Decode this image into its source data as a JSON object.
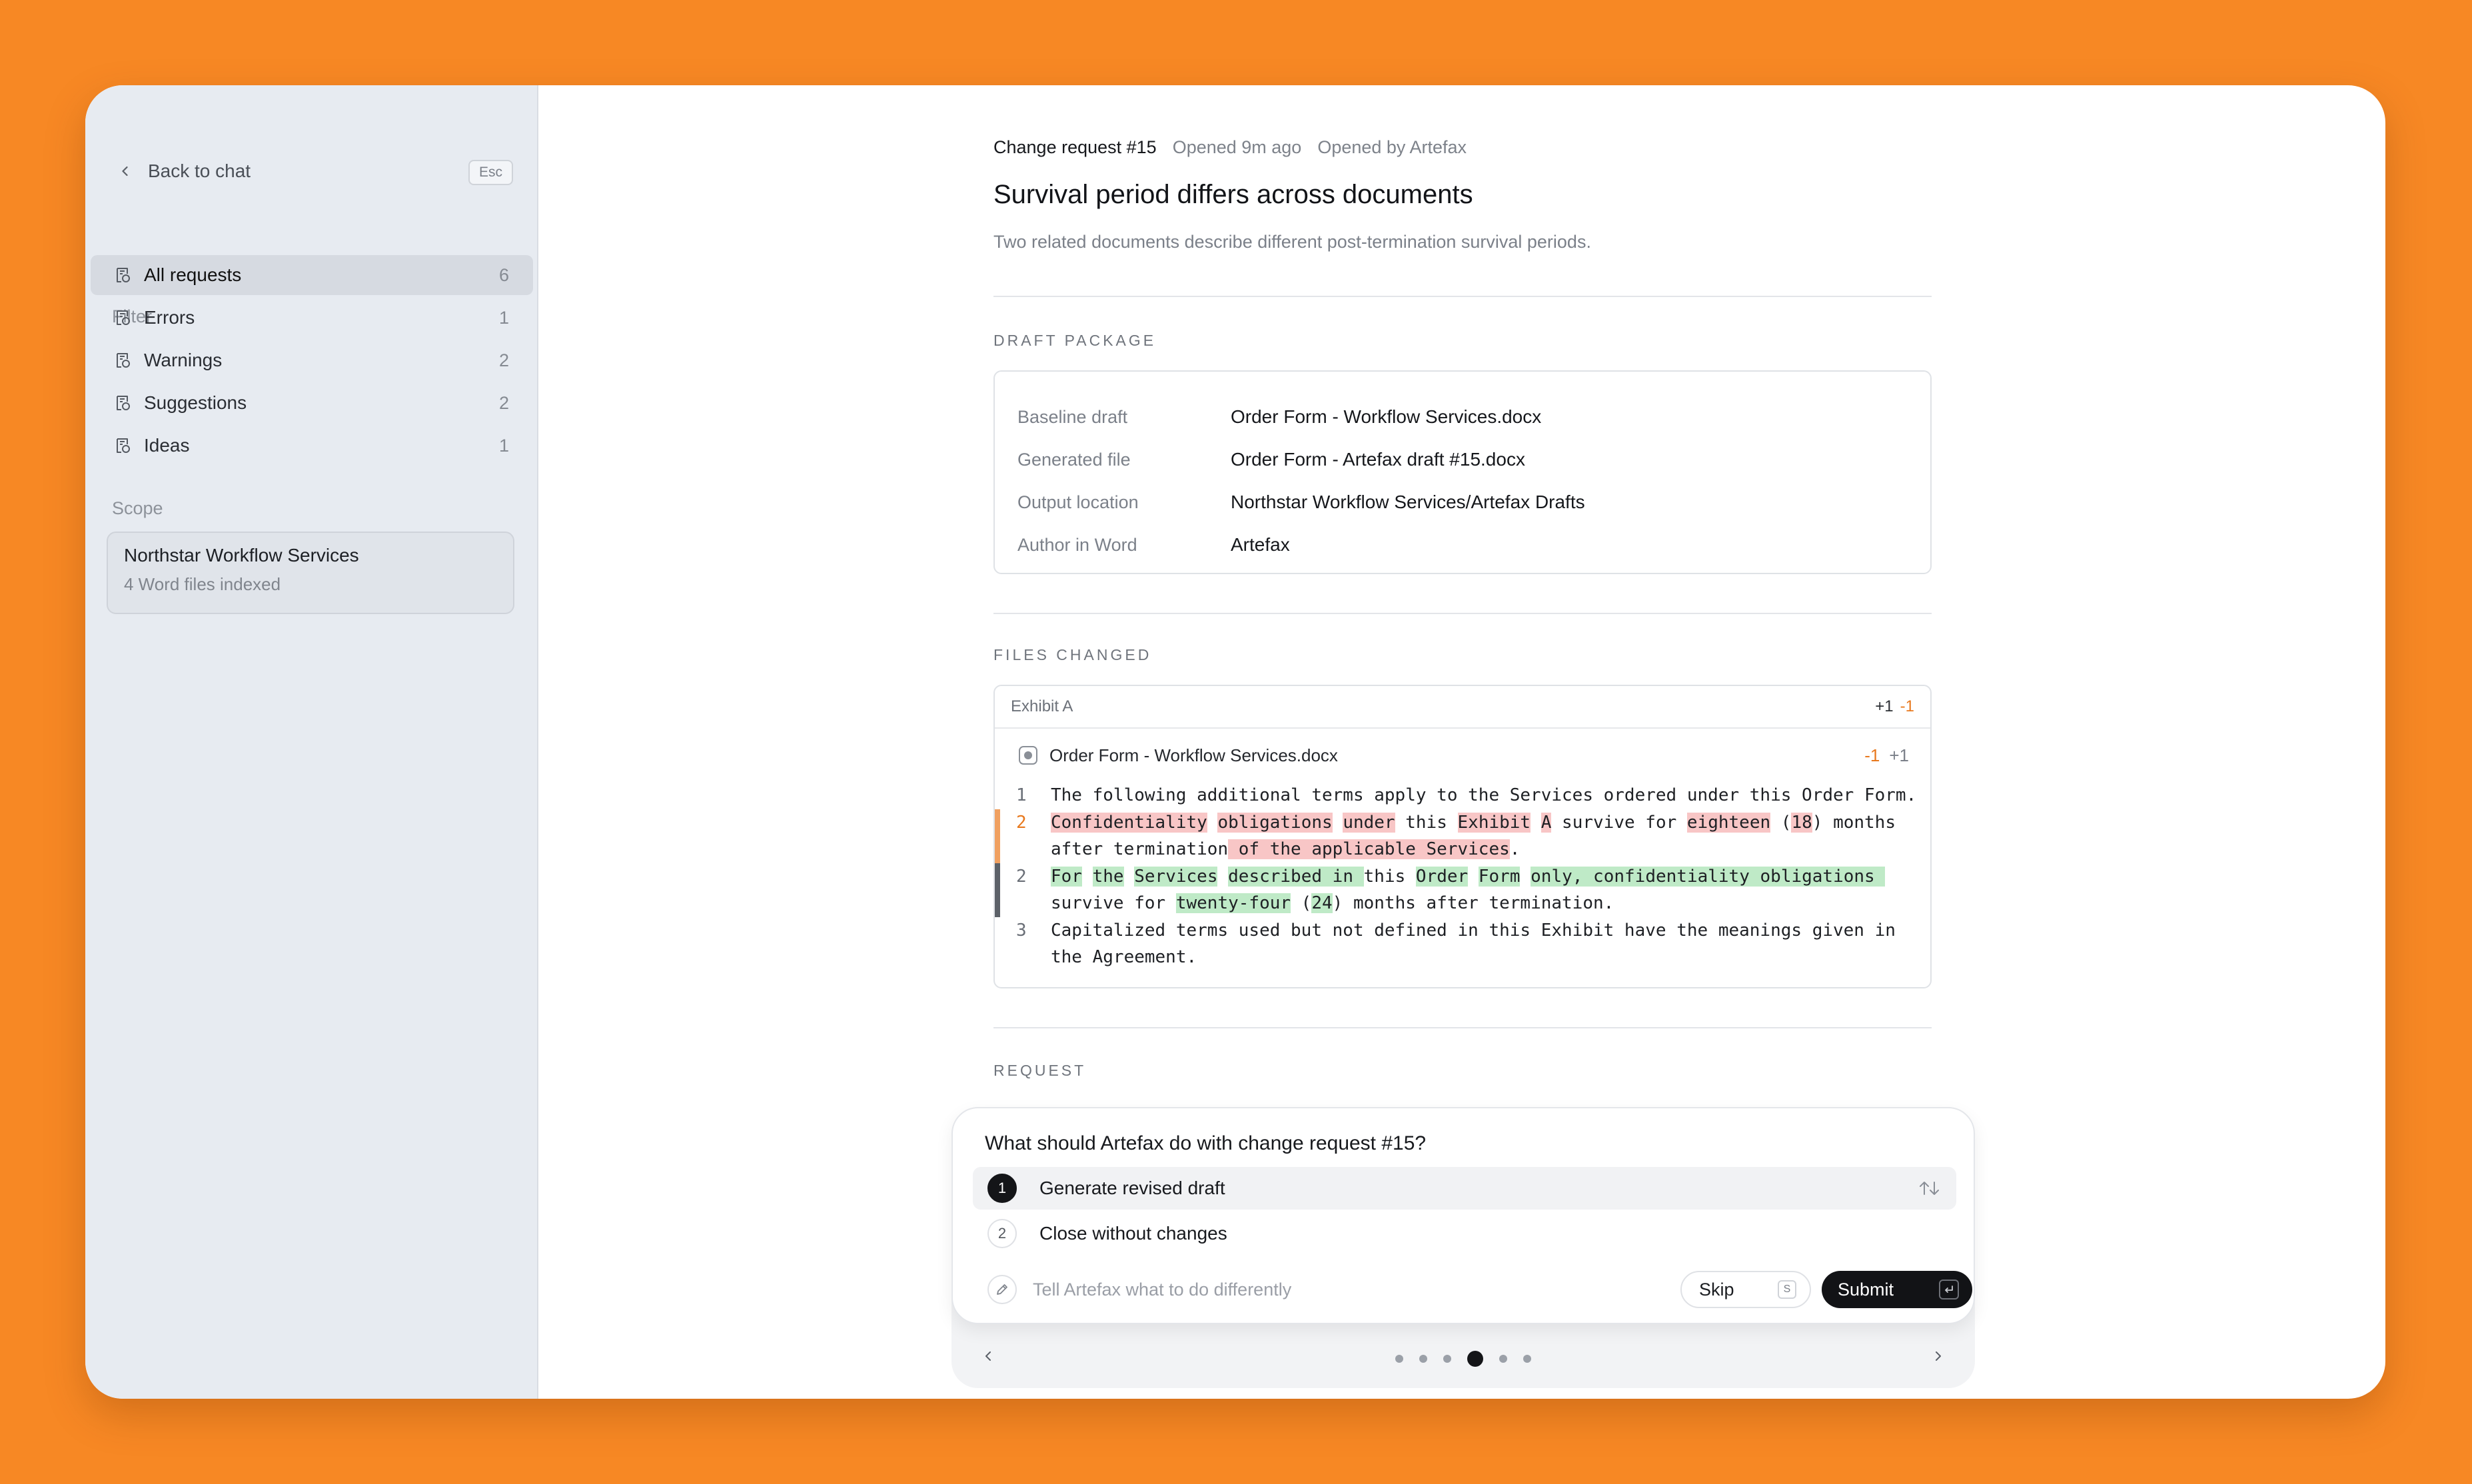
{
  "sidebar": {
    "back_label": "Back to chat",
    "esc_key": "Esc",
    "filter_label": "Filter",
    "filters": [
      {
        "label": "All requests",
        "count": "6",
        "active": true
      },
      {
        "label": "Errors",
        "count": "1"
      },
      {
        "label": "Warnings",
        "count": "2"
      },
      {
        "label": "Suggestions",
        "count": "2"
      },
      {
        "label": "Ideas",
        "count": "1"
      }
    ],
    "scope_label": "Scope",
    "scope": {
      "title": "Northstar Workflow Services",
      "subtitle": "4 Word files indexed"
    }
  },
  "request": {
    "id": "Change request #15",
    "opened": "Opened 9m ago",
    "opened_by": "Opened by Artefax",
    "title": "Survival period differs across documents",
    "description": "Two related documents describe different post-termination survival periods."
  },
  "draft_package": {
    "caption": "DRAFT PACKAGE",
    "rows": [
      {
        "key": "Baseline draft",
        "value": "Order Form - Workflow Services.docx"
      },
      {
        "key": "Generated file",
        "value": "Order Form - Artefax draft #15.docx"
      },
      {
        "key": "Output location",
        "value": "Northstar Workflow Services/Artefax Drafts"
      },
      {
        "key": "Author in Word",
        "value": "Artefax"
      }
    ]
  },
  "files_changed": {
    "caption": "FILES CHANGED",
    "section": "Exhibit A",
    "header_add": "+1",
    "header_del": "-1",
    "file_name": "Order Form - Workflow Services.docx",
    "file_del": "-1",
    "file_add": "+1",
    "lines": [
      {
        "num": "1",
        "kind": "ctx",
        "segments": [
          {
            "t": "The following additional terms apply to the Services ordered under this Order Form."
          }
        ]
      },
      {
        "num": "2",
        "kind": "rem",
        "segments": [
          {
            "t": "Confidentiality",
            "h": "r"
          },
          {
            "t": " "
          },
          {
            "t": "obligations",
            "h": "r"
          },
          {
            "t": " "
          },
          {
            "t": "under",
            "h": "r"
          },
          {
            "t": " this "
          },
          {
            "t": "Exhibit",
            "h": "r"
          },
          {
            "t": " "
          },
          {
            "t": "A",
            "h": "r"
          },
          {
            "t": " survive for "
          },
          {
            "t": "eighteen",
            "h": "r"
          },
          {
            "t": " ("
          },
          {
            "t": "18",
            "h": "r"
          },
          {
            "t": ") months after termination"
          },
          {
            "t": " of the applicable Services",
            "h": "r"
          },
          {
            "t": "."
          }
        ]
      },
      {
        "num": "2",
        "kind": "addl",
        "segments": [
          {
            "t": "For",
            "h": "g"
          },
          {
            "t": " "
          },
          {
            "t": "the",
            "h": "g"
          },
          {
            "t": " "
          },
          {
            "t": "Services",
            "h": "g"
          },
          {
            "t": " "
          },
          {
            "t": "described in ",
            "h": "g"
          },
          {
            "t": "this "
          },
          {
            "t": "Order",
            "h": "g"
          },
          {
            "t": " "
          },
          {
            "t": "Form",
            "h": "g"
          },
          {
            "t": " "
          },
          {
            "t": "only, confidentiality obligations ",
            "h": "g"
          },
          {
            "t": " survive for "
          },
          {
            "t": "twenty-four",
            "h": "g"
          },
          {
            "t": " ("
          },
          {
            "t": "24",
            "h": "g"
          },
          {
            "t": ") months after termination."
          }
        ]
      },
      {
        "num": "3",
        "kind": "ctx",
        "segments": [
          {
            "t": "Capitalized terms used but not defined in this Exhibit have the meanings given in the Agreement."
          }
        ]
      }
    ]
  },
  "request_section": {
    "caption": "REQUEST"
  },
  "question": {
    "prompt": "What should Artefax do with change request #15?",
    "options": [
      {
        "num": "1",
        "label": "Generate revised draft",
        "selected": true
      },
      {
        "num": "2",
        "label": "Close without changes"
      }
    ],
    "input_placeholder": "Tell Artefax what to do differently",
    "skip_label": "Skip",
    "skip_key": "S",
    "submit_label": "Submit",
    "pager_current": 4,
    "pager_total": 6
  },
  "colors": {
    "background": "#F78824",
    "accent_removed": "#E8791E",
    "removed_bg": "#F8C6C6",
    "added_bg": "#BFEAC7"
  }
}
